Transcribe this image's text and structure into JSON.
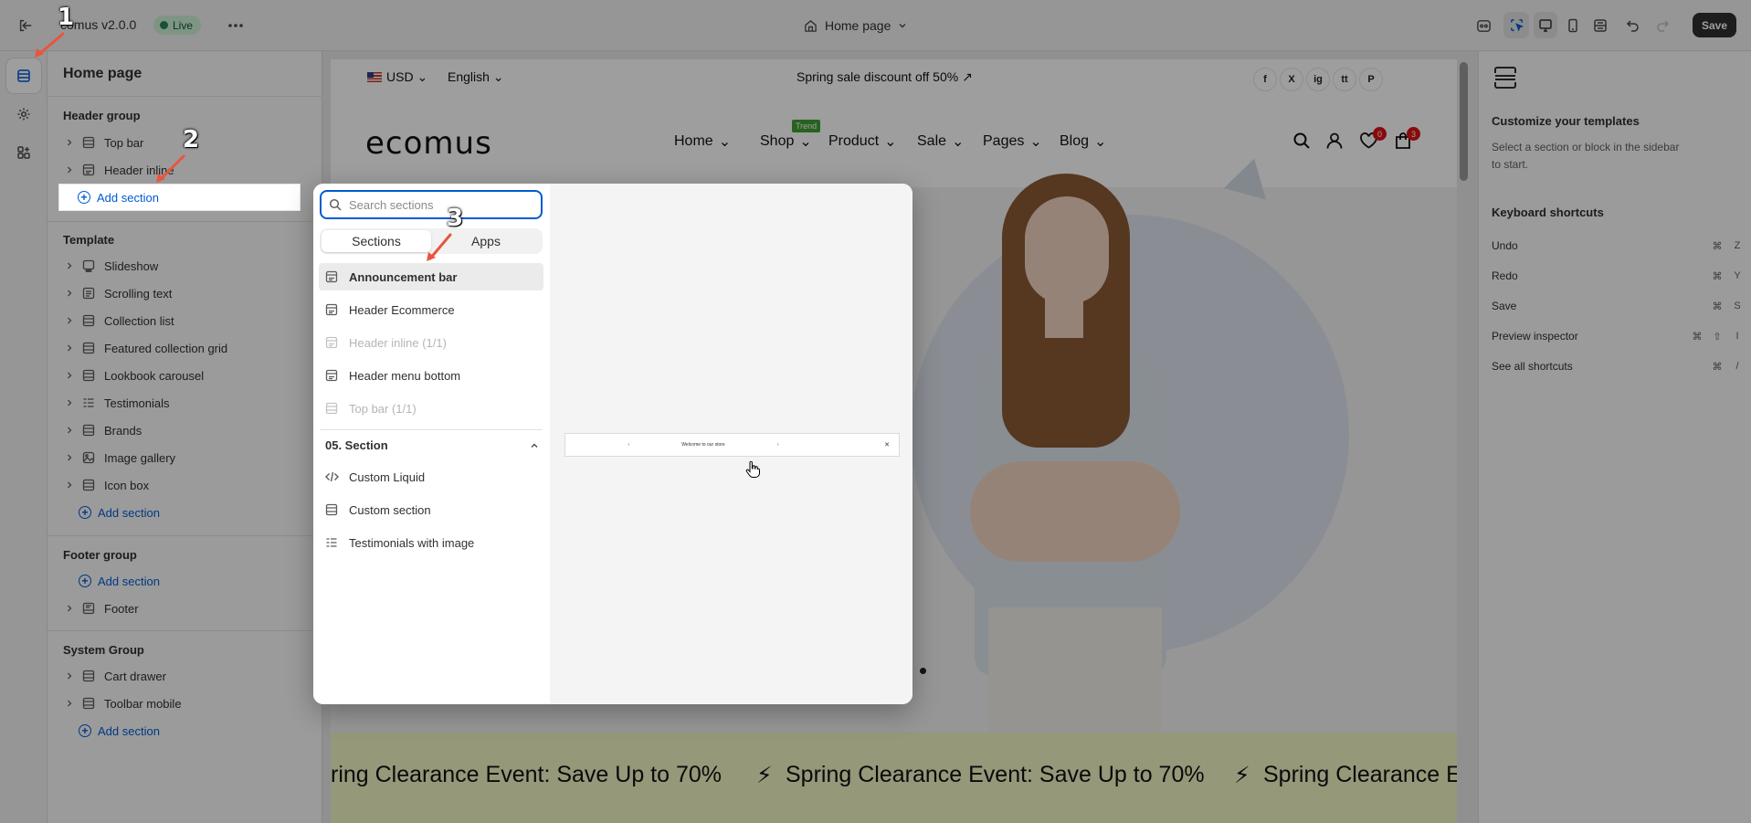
{
  "topbar": {
    "title": "comus v2.0.0",
    "live_label": "Live",
    "page_selector": "Home page",
    "save_label": "Save"
  },
  "sidebar": {
    "title": "Home page",
    "header_group": {
      "title": "Header group",
      "items": [
        {
          "label": "Top bar",
          "icon": "section-icon"
        },
        {
          "label": "Header inline",
          "icon": "header-icon"
        }
      ],
      "add_label": "Add section"
    },
    "template": {
      "title": "Template",
      "items": [
        {
          "label": "Slideshow",
          "icon": "slideshow-icon"
        },
        {
          "label": "Scrolling text",
          "icon": "text-icon"
        },
        {
          "label": "Collection list",
          "icon": "section-icon"
        },
        {
          "label": "Featured collection grid",
          "icon": "section-icon"
        },
        {
          "label": "Lookbook carousel",
          "icon": "section-icon"
        },
        {
          "label": "Testimonials",
          "icon": "list-icon"
        },
        {
          "label": "Brands",
          "icon": "section-icon"
        },
        {
          "label": "Image gallery",
          "icon": "image-icon"
        },
        {
          "label": "Icon box",
          "icon": "section-icon"
        }
      ],
      "add_label": "Add section"
    },
    "footer_group": {
      "title": "Footer group",
      "add_label": "Add section",
      "items": [
        {
          "label": "Footer",
          "icon": "footer-icon"
        }
      ]
    },
    "system_group": {
      "title": "System Group",
      "items": [
        {
          "label": "Cart drawer",
          "icon": "section-icon"
        },
        {
          "label": "Toolbar mobile",
          "icon": "section-icon"
        }
      ],
      "add_label": "Add section"
    }
  },
  "picker": {
    "search_placeholder": "Search sections",
    "tabs": [
      "Sections",
      "Apps"
    ],
    "items": [
      {
        "label": "Announcement bar",
        "state": "selected",
        "icon": "header-icon"
      },
      {
        "label": "Header Ecommerce",
        "state": "normal",
        "icon": "header-icon"
      },
      {
        "label": "Header inline (1/1)",
        "state": "disabled",
        "icon": "header-icon"
      },
      {
        "label": "Header menu bottom",
        "state": "normal",
        "icon": "header-icon"
      },
      {
        "label": "Top bar (1/1)",
        "state": "disabled",
        "icon": "section-icon"
      }
    ],
    "group_title": "05. Section",
    "group_items": [
      {
        "label": "Custom Liquid",
        "icon": "code-icon"
      },
      {
        "label": "Custom section",
        "icon": "section-icon"
      },
      {
        "label": "Testimonials with image",
        "icon": "list-icon"
      }
    ],
    "preview_text": "Welcome to our store"
  },
  "store": {
    "currency": "USD",
    "language": "English",
    "promo": "Spring sale discount off 50%",
    "logo": "ecomus",
    "nav": [
      "Home",
      "Shop",
      "Product",
      "Sale",
      "Pages",
      "Blog"
    ],
    "trend_badge": "Trend",
    "wishlist_count": "0",
    "cart_count": "3",
    "social": [
      "f",
      "X",
      "ig",
      "tt",
      "P"
    ],
    "scrolling_text": "Spring Clearance Event: Save Up to 70%",
    "scroll_fragment_left": "ring Clearance Event: Save Up to 70%",
    "scroll_fragment_right": "Spring Clearance Ev"
  },
  "right_panel": {
    "title": "Customize your templates",
    "description": "Select a section or block in the sidebar to start.",
    "shortcuts_title": "Keyboard shortcuts",
    "shortcuts": [
      {
        "label": "Undo",
        "keys": [
          "⌘",
          "Z"
        ]
      },
      {
        "label": "Redo",
        "keys": [
          "⌘",
          "Y"
        ]
      },
      {
        "label": "Save",
        "keys": [
          "⌘",
          "S"
        ]
      },
      {
        "label": "Preview inspector",
        "keys": [
          "⌘",
          "⇧",
          "I"
        ]
      },
      {
        "label": "See all shortcuts",
        "keys": [
          "⌘",
          "/"
        ]
      }
    ]
  },
  "annotations": [
    "1",
    "2",
    "3"
  ],
  "colors": {
    "accent": "#005bd3",
    "live_bg": "#cdf0d3",
    "live_dot": "#29845a",
    "badge_red": "#db1215",
    "trend_green": "#3f9e32",
    "scroll_band": "#f1f5c3",
    "annotation_arrow": "#e8553f"
  }
}
